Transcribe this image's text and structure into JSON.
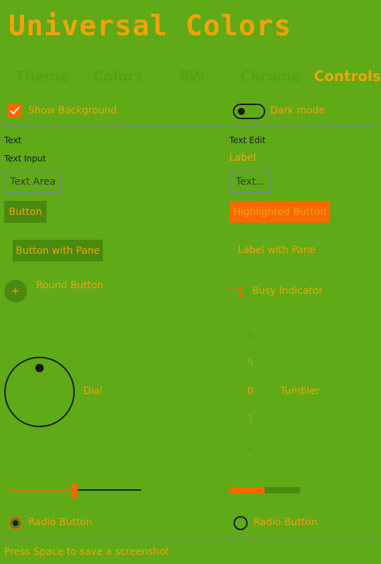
{
  "app": {
    "title": "Universal Colors"
  },
  "tabs": [
    {
      "label": "Theme"
    },
    {
      "label": "Colors"
    },
    {
      "label": "BW"
    },
    {
      "label": "Chrome"
    },
    {
      "label": "Controls"
    }
  ],
  "options": {
    "show_background_label": "Show Background",
    "show_background_checked": true,
    "dark_mode_label": "Dark mode",
    "dark_mode_on": false
  },
  "controls": {
    "text_label": "Text",
    "text_edit_label": "Text Edit",
    "text_input_label": "Text Input",
    "label_label": "Label",
    "text_area_placeholder": "Text Area",
    "text_field_placeholder": "Text...",
    "button_label": "Button",
    "highlighted_button_label": "Highlighted Button",
    "button_with_pane_label": "Button with Pane",
    "label_with_pane": "Label with Pane",
    "round_button_glyph": "+",
    "round_button_label": "Round Button",
    "busy_indicator_label": "Busy Indicator",
    "dial_label": "Dial",
    "tumbler_label": "Tumbler",
    "tumbler_items": [
      "8",
      "9",
      "0",
      "1",
      "2"
    ],
    "tumbler_selected_index": 2,
    "slider_value": 0.5,
    "progress_value": 0.5,
    "radio_left_label": "Radio Button",
    "radio_left_checked": true,
    "radio_right_label": "Radio Button",
    "radio_right_checked": false
  },
  "footer": {
    "hint": "Press Space to save a screenshot"
  },
  "colors": {
    "background": "#60a917",
    "accent": "#f0a30a",
    "highlight": "#fa6800",
    "button": "#4a8a0e",
    "inactive_tab": "#56a114"
  }
}
